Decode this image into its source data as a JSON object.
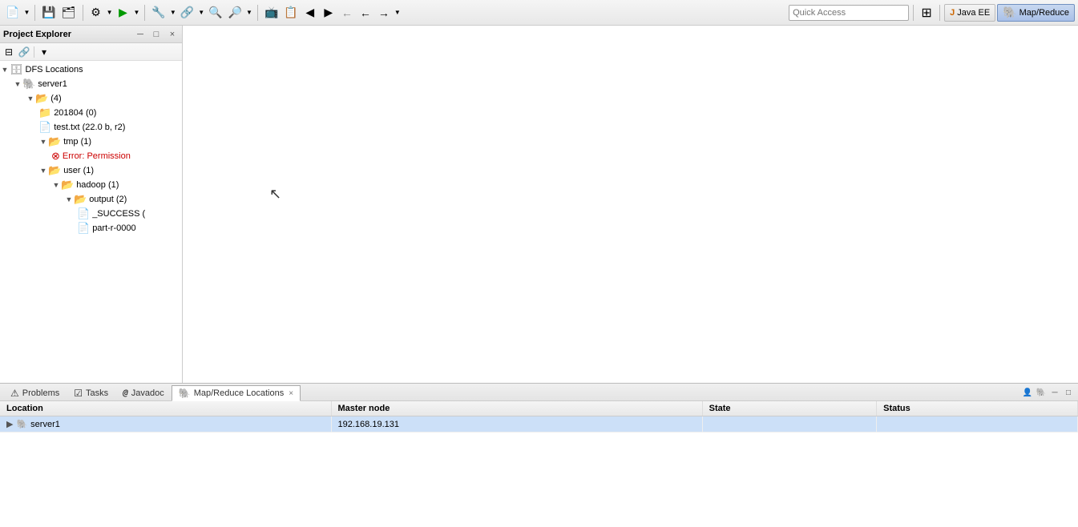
{
  "toolbar": {
    "quick_access_placeholder": "Quick Access",
    "perspective_java_ee": "Java EE",
    "perspective_map_reduce": "Map/Reduce"
  },
  "project_explorer": {
    "title": "Project Explorer",
    "close_label": "×",
    "minimize_label": "─",
    "maximize_label": "□",
    "tree": {
      "dfs_locations": "DFS Locations",
      "server1": "server1",
      "folder_4": "(4)",
      "folder_201804": "201804 (0)",
      "file_test": "test.txt (22.0 b, r2)",
      "folder_tmp": "tmp (1)",
      "error_permission": "Error: Permission",
      "folder_user": "user (1)",
      "folder_hadoop": "hadoop (1)",
      "folder_output": "output (2)",
      "file_success": "_SUCCESS (",
      "file_part": "part-r-0000"
    }
  },
  "bottom_panel": {
    "tabs": [
      {
        "id": "problems",
        "label": "Problems",
        "icon": "⚠"
      },
      {
        "id": "tasks",
        "label": "Tasks",
        "icon": "☑"
      },
      {
        "id": "javadoc",
        "label": "Javadoc",
        "icon": "@"
      },
      {
        "id": "map_reduce",
        "label": "Map/Reduce Locations",
        "icon": "🐘",
        "active": true
      }
    ],
    "table": {
      "headers": [
        "Location",
        "Master node",
        "State",
        "Status"
      ],
      "rows": [
        {
          "location": "server1",
          "master_node": "192.168.19.131",
          "state": "",
          "status": "",
          "selected": true
        }
      ]
    }
  }
}
